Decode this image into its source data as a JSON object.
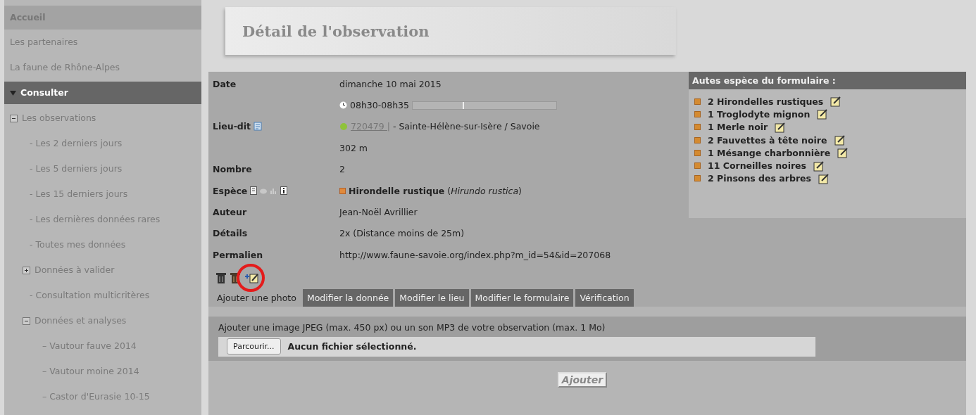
{
  "sidebar": {
    "items": [
      {
        "kind": "header",
        "label": "Accueil"
      },
      {
        "kind": "link",
        "label": "Les partenaires"
      },
      {
        "kind": "link",
        "label": "La faune de Rhône-Alpes"
      },
      {
        "kind": "section",
        "label": "Consulter",
        "expanded": true,
        "children": [
          {
            "kind": "node",
            "label": "Les observations",
            "expanded": true,
            "children": [
              {
                "kind": "link",
                "label": "- Les 2 derniers jours"
              },
              {
                "kind": "link",
                "label": "- Les 5 derniers jours"
              },
              {
                "kind": "link",
                "label": "- Les 15 derniers jours"
              },
              {
                "kind": "link",
                "label": "- Les dernières données rares"
              },
              {
                "kind": "link",
                "label": "- Toutes mes données"
              },
              {
                "kind": "node",
                "label": "Données à valider",
                "expanded": false
              },
              {
                "kind": "link",
                "label": "- Consultation multicritères"
              },
              {
                "kind": "node",
                "label": "Données et analyses",
                "expanded": true,
                "children": [
                  {
                    "kind": "link",
                    "label": "– Vautour fauve 2014"
                  },
                  {
                    "kind": "link",
                    "label": "– Vautour moine 2014"
                  },
                  {
                    "kind": "link",
                    "label": "– Castor d'Eurasie 10-15"
                  }
                ]
              }
            ]
          }
        ]
      }
    ]
  },
  "page_title": "Détail de l'observation",
  "fields": [
    {
      "kind": "text",
      "label": "Date",
      "value": "dimanche 10 mai 2015"
    },
    {
      "kind": "time",
      "value": "08h30-08h35",
      "level": 0.35
    },
    {
      "kind": "place",
      "label": "Lieu-dit",
      "code": "720479 |",
      "value": " - Sainte-Hélène-sur-Isère / Savoie"
    },
    {
      "kind": "text",
      "value": "302 m"
    },
    {
      "kind": "text",
      "label": "Nombre",
      "value": "2"
    },
    {
      "kind": "species",
      "label": "Espèce",
      "value": "**Hirondelle rustique** (*Hirundo rustica*)"
    },
    {
      "kind": "text",
      "label": "Auteur",
      "value": "Jean-Noël Avrillier"
    },
    {
      "kind": "text",
      "label": "Détails",
      "value": "2x (Distance moins de 25m)"
    },
    {
      "kind": "text",
      "label": "Permalien",
      "value": "http://www.faune-savoie.org/index.php?m_id=54&id=207068"
    }
  ],
  "other_species": {
    "title": "Autes espèce du formulaire :",
    "items": [
      {
        "count": "2",
        "name": "Hirondelles rustiques"
      },
      {
        "count": "1",
        "name": "Troglodyte mignon"
      },
      {
        "count": "1",
        "name": "Merle noir"
      },
      {
        "count": "2",
        "name": "Fauvettes à tête noire"
      },
      {
        "count": "1",
        "name": "Mésange charbonnière"
      },
      {
        "count": "11",
        "name": "Corneilles noires"
      },
      {
        "count": "2",
        "name": "Pinsons des arbres"
      }
    ]
  },
  "tabs": [
    {
      "label": "Ajouter une photo",
      "selected": true
    },
    {
      "label": "Modifier la donnée",
      "selected": false
    },
    {
      "label": "Modifier le lieu",
      "selected": false
    },
    {
      "label": "Modifier le formulaire",
      "selected": false
    },
    {
      "label": "Vérification",
      "selected": false
    }
  ],
  "upload": {
    "instructions": "Ajouter une image JPEG (max. 450 px) ou un son MP3 de votre observation (max. 1 Mo)",
    "browse_button": "Parcourir...",
    "file_status": "Aucun fichier sélectionné.",
    "submit": "Ajouter"
  }
}
